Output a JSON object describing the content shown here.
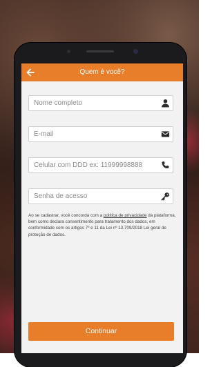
{
  "header": {
    "title": "Quem é você?",
    "back_icon": "arrow-left-icon"
  },
  "form": {
    "name_placeholder": "Nome completo",
    "email_placeholder": "E-mail",
    "phone_placeholder": "Celular com DDD ex: 11999998888",
    "password_placeholder": "Senha de acesso"
  },
  "icons": {
    "name": "user-icon",
    "email": "envelope-icon",
    "phone": "phone-icon",
    "password": "key-icon"
  },
  "legal": {
    "before_link": "Ao se cadastrar, você concorda com a ",
    "link": "política de privacidade",
    "after_link": " da plataforma, bem como declara consentimento para tratamento dos dados, em conformidade com os artigos 7º e 11 da Lei nº 13.709/2018 Lei geral de proteção de dados."
  },
  "cta": {
    "label": "Continuar"
  },
  "colors": {
    "accent": "#e87d2a",
    "background": "#f2f2f2",
    "icon": "#2b2b2b"
  }
}
